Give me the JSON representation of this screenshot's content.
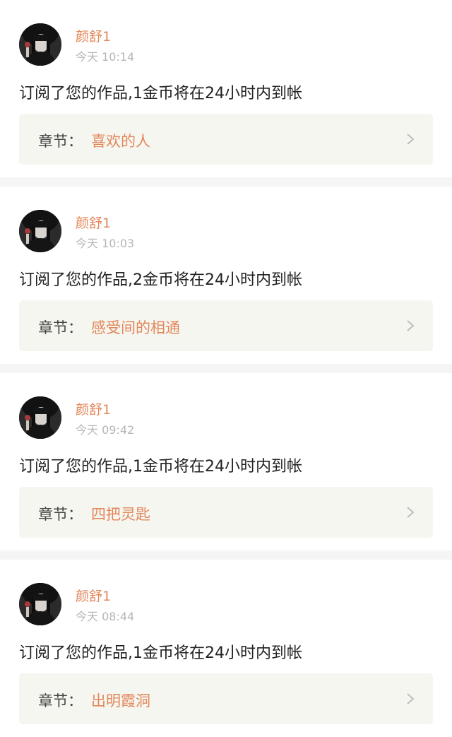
{
  "notifications": [
    {
      "username": "颜舒1",
      "time": "今天 10:14",
      "message": "订阅了您的作品,1金币将在24小时内到帐",
      "chapter_label": "章节：",
      "chapter_title": "喜欢的人"
    },
    {
      "username": "颜舒1",
      "time": "今天 10:03",
      "message": "订阅了您的作品,2金币将在24小时内到帐",
      "chapter_label": "章节：",
      "chapter_title": "感受间的相通"
    },
    {
      "username": "颜舒1",
      "time": "今天 09:42",
      "message": "订阅了您的作品,1金币将在24小时内到帐",
      "chapter_label": "章节：",
      "chapter_title": "四把灵匙"
    },
    {
      "username": "颜舒1",
      "time": "今天 08:44",
      "message": "订阅了您的作品,1金币将在24小时内到帐",
      "chapter_label": "章节：",
      "chapter_title": "出明霞洞"
    }
  ],
  "icons": {
    "avatar": "user-avatar-photo",
    "chevron": "chevron-right-icon"
  },
  "colors": {
    "accent": "#e3875a",
    "background": "#f5f5f5",
    "card": "#ffffff",
    "chapter_box": "#f6f6f1",
    "timestamp": "#b6b6b6"
  }
}
